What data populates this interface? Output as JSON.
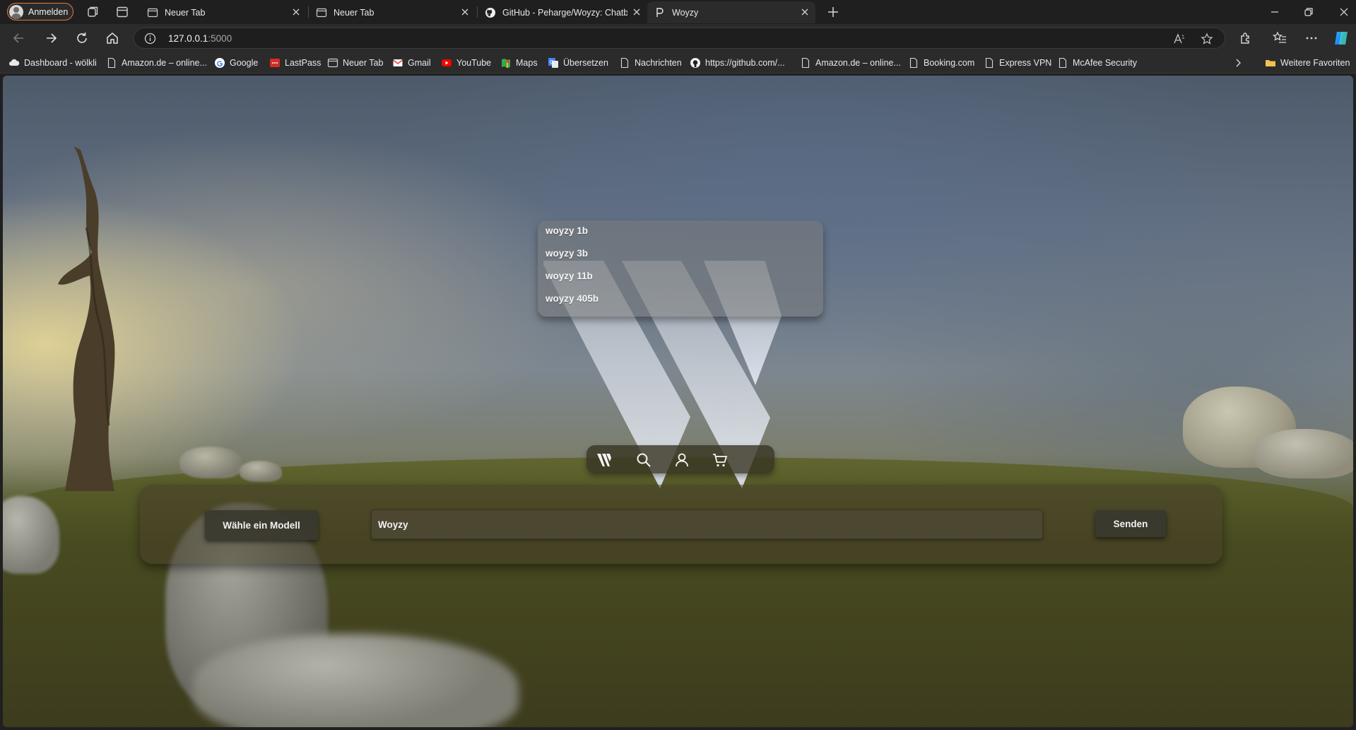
{
  "browser": {
    "profile_label": "Anmelden",
    "tabs": [
      {
        "label": "Neuer Tab",
        "icon": "tab-page-icon"
      },
      {
        "label": "Neuer Tab",
        "icon": "tab-page-icon"
      },
      {
        "label": "GitHub - Peharge/Woyzy: Chatbo",
        "icon": "github-icon"
      },
      {
        "label": "Woyzy",
        "icon": "woyzy-favicon"
      }
    ],
    "url_host": "127.0.0.1",
    "url_port": ":5000",
    "bookmarks": [
      {
        "label": "Dashboard - wölkli",
        "icon": "cloud-icon"
      },
      {
        "label": "Amazon.de – online...",
        "icon": "page-icon"
      },
      {
        "label": "Google",
        "icon": "google-icon"
      },
      {
        "label": "LastPass",
        "icon": "lastpass-icon"
      },
      {
        "label": "Neuer Tab",
        "icon": "tab-page-icon"
      },
      {
        "label": "Gmail",
        "icon": "gmail-icon"
      },
      {
        "label": "YouTube",
        "icon": "youtube-icon"
      },
      {
        "label": "Maps",
        "icon": "maps-icon"
      },
      {
        "label": "Übersetzen",
        "icon": "translate-icon"
      },
      {
        "label": "Nachrichten",
        "icon": "page-icon"
      },
      {
        "label": "https://github.com/...",
        "icon": "github-icon"
      },
      {
        "label": "Amazon.de – online...",
        "icon": "page-icon"
      },
      {
        "label": "Booking.com",
        "icon": "page-icon"
      },
      {
        "label": "Express VPN",
        "icon": "page-icon"
      },
      {
        "label": "McAfee Security",
        "icon": "page-icon"
      }
    ],
    "more_favorites": "Weitere Favoriten"
  },
  "app": {
    "models": [
      "woyzy 1b",
      "woyzy 3b",
      "woyzy 11b",
      "woyzy 405b"
    ],
    "model_button_label": "Wähle ein Modell",
    "input_value": "Woyzy",
    "send_label": "Senden",
    "icon_bar": [
      "woyzy-logo-icon",
      "search-icon",
      "user-icon",
      "cart-icon"
    ]
  },
  "colors": {
    "profile_border": "#e77b3b",
    "tab_bar": "#1f1f1f",
    "toolbar": "#2b2b2b"
  }
}
